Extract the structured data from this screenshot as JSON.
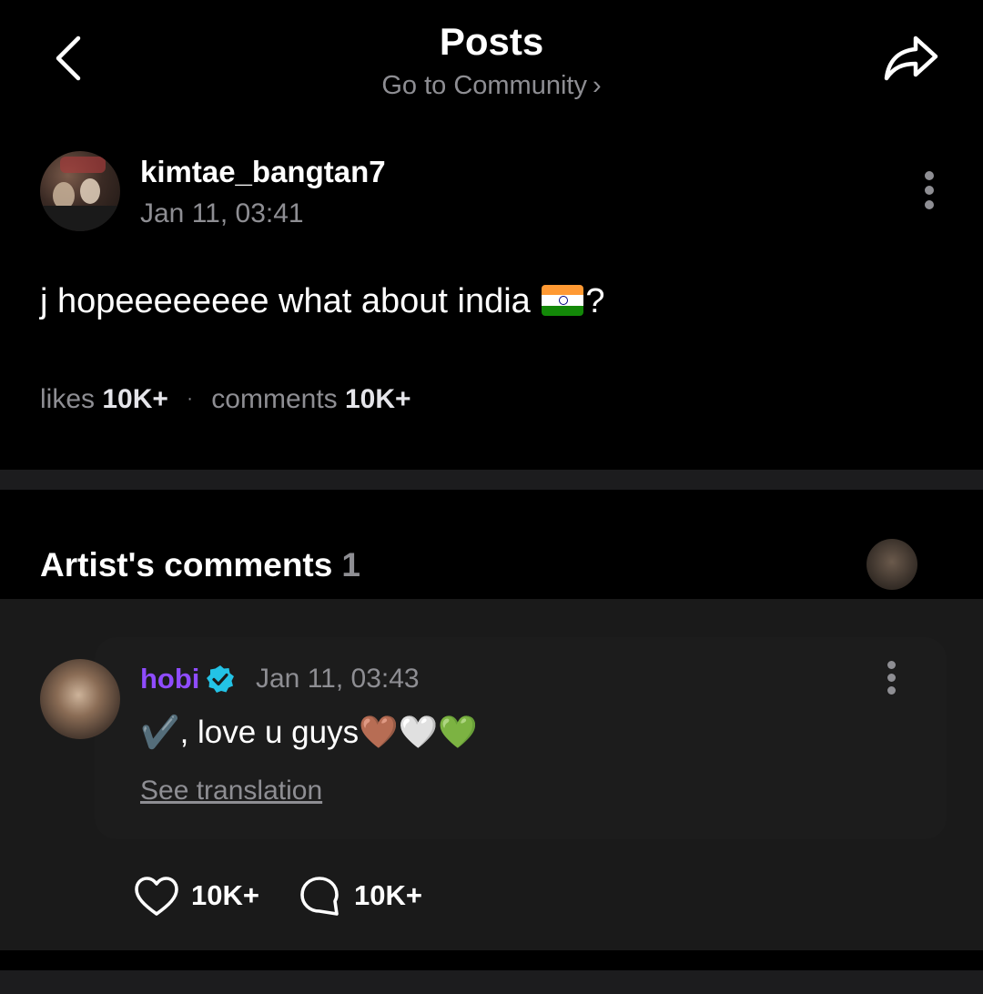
{
  "header": {
    "title": "Posts",
    "community_link": "Go to Community",
    "chevron": "›",
    "back_icon": "chevron-left-icon",
    "share_icon": "share-arrow-icon"
  },
  "post": {
    "author": "kimtae_bangtan7",
    "timestamp": "Jan 11, 03:41",
    "text_before_flag": "j hopeeeeeeee what about india ",
    "flag_emoji": "india-flag",
    "text_after_flag": "?",
    "likes_label": "likes",
    "likes_count": "10K+",
    "separator": "·",
    "comments_label": "comments",
    "comments_count": "10K+"
  },
  "artist_comments": {
    "title": "Artist's comments",
    "count": "1",
    "comment": {
      "author": "hobi",
      "verified": true,
      "timestamp": "Jan 11, 03:43",
      "text": "✔️, love u guys🤎🤍💚",
      "translate_label": "See translation",
      "likes": "10K+",
      "replies": "10K+"
    }
  },
  "colors": {
    "background": "#000000",
    "muted": "#8e8e93",
    "artist_name": "#8f4cff",
    "verified_badge": "#23c3e6"
  }
}
